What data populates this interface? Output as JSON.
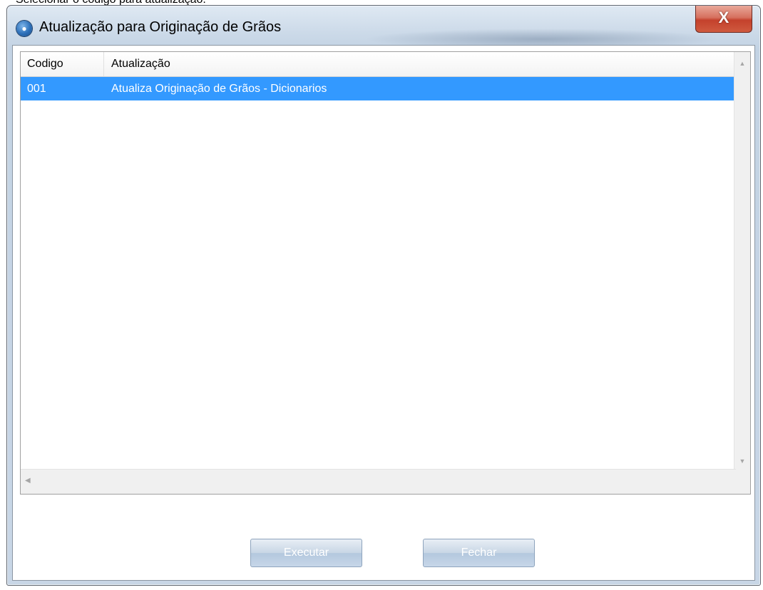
{
  "instruction": "Selecionar o código para atualização.",
  "window": {
    "title": "Atualização para Originação de Grãos",
    "close_glyph": "X"
  },
  "list": {
    "columns": [
      "Codigo",
      "Atualização"
    ],
    "rows": [
      {
        "code": "001",
        "update": "Atualiza Originação de Grãos - Dicionarios",
        "selected": true
      }
    ]
  },
  "buttons": {
    "execute": "Executar",
    "close": "Fechar"
  },
  "colors": {
    "selection": "#3399ff",
    "close_button": "#c4412c"
  }
}
